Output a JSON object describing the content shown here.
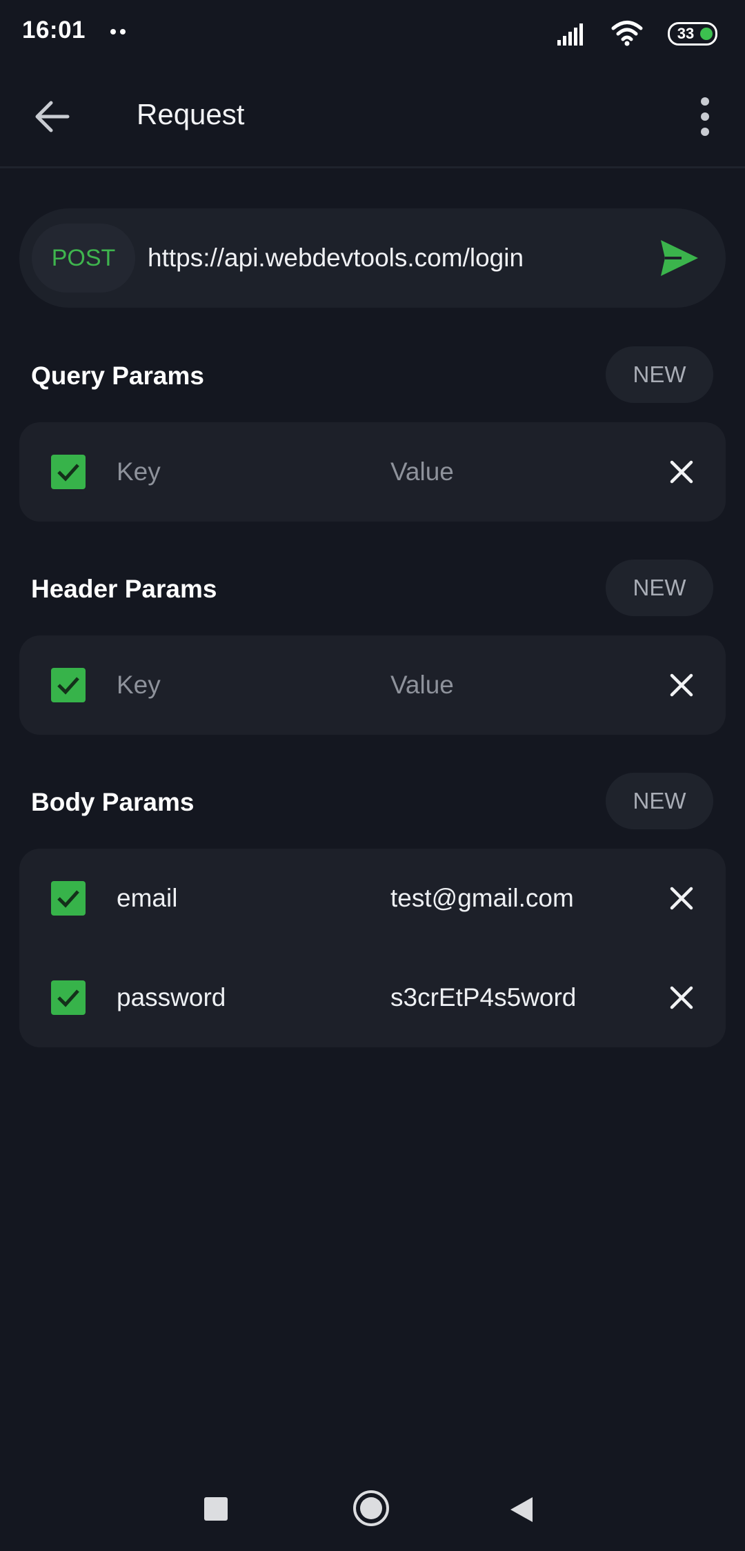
{
  "status_bar": {
    "time": "16:01",
    "battery_level": "33",
    "icons": [
      "signal-icon",
      "wifi-icon",
      "battery-icon"
    ]
  },
  "app_bar": {
    "title": "Request",
    "back_icon": "arrow-left-icon",
    "menu_icon": "more-vertical-icon"
  },
  "request": {
    "method": "POST",
    "url": "https://api.webdevtools.com/login",
    "send_icon": "send-icon"
  },
  "query_params": {
    "title": "Query Params",
    "new_label": "NEW",
    "rows": [
      {
        "checked": true,
        "key": "",
        "value": "",
        "key_placeholder": "Key",
        "value_placeholder": "Value"
      }
    ]
  },
  "header_params": {
    "title": "Header Params",
    "new_label": "NEW",
    "rows": [
      {
        "checked": true,
        "key": "",
        "value": "",
        "key_placeholder": "Key",
        "value_placeholder": "Value"
      }
    ]
  },
  "body_params": {
    "title": "Body Params",
    "new_label": "NEW",
    "rows": [
      {
        "checked": true,
        "key": "email",
        "value": "test@gmail.com"
      },
      {
        "checked": true,
        "key": "password",
        "value": "s3crEtP4s5word"
      }
    ]
  },
  "colors": {
    "background": "#141720",
    "card": "#1d2029",
    "accent_green": "#37b34a",
    "text_primary": "#eef0f3",
    "text_placeholder": "#8e929b"
  }
}
